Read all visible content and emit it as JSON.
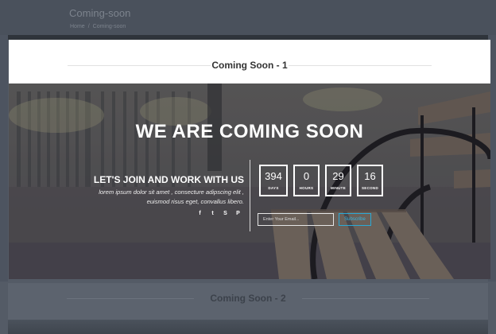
{
  "page": {
    "title": "Coming-soon",
    "breadcrumb": [
      "Home",
      "/",
      "Coming-soon"
    ]
  },
  "modal": {
    "title": "Coming Soon - 1"
  },
  "hero": {
    "heading": "WE ARE COMING SOON",
    "join_title": "LET'S JOIN AND WORK WITH US",
    "join_text": "lorem ipsum dolor sit amet , consecture adipscing elit , euismod risus eget, convallus libero.",
    "social_icons": [
      "facebook-icon",
      "twitter-icon",
      "skype-icon",
      "pinterest-icon"
    ],
    "social_glyphs": [
      "f",
      "t",
      "S",
      "P"
    ]
  },
  "countdown": [
    {
      "value": "394",
      "label": "DAYS"
    },
    {
      "value": "0",
      "label": "HOURS"
    },
    {
      "value": "29",
      "label": "MINUTE"
    },
    {
      "value": "16",
      "label": "SECOND"
    }
  ],
  "subscribe": {
    "placeholder": "Enter Your Email...",
    "button_label": "Subscribe"
  },
  "section2": {
    "title": "Coming Soon - 2"
  },
  "colors": {
    "accent": "#2aa9d6",
    "overlay": "#545b66"
  }
}
